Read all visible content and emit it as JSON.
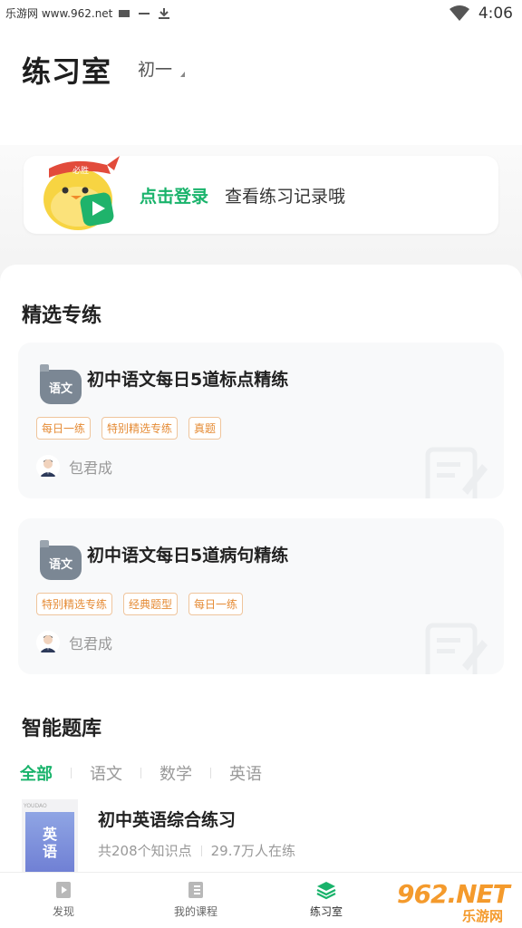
{
  "status_bar": {
    "site_text": "乐游网 www.962.net",
    "time": "4:06"
  },
  "header": {
    "title": "练习室",
    "grade": "初一"
  },
  "login_card": {
    "link_label": "点击登录",
    "tip": "查看练习记录哦",
    "mascot_badge": "必胜"
  },
  "featured": {
    "section_title": "精选专练",
    "cards": [
      {
        "subject": "语文",
        "title": "初中语文每日5道标点精练",
        "tags": [
          "每日一练",
          "特别精选专练",
          "真题"
        ],
        "teacher": "包君成"
      },
      {
        "subject": "语文",
        "title": "初中语文每日5道病句精练",
        "tags": [
          "特别精选专练",
          "经典题型",
          "每日一练"
        ],
        "teacher": "包君成"
      }
    ]
  },
  "bank": {
    "section_title": "智能题库",
    "tabs": [
      "全部",
      "语文",
      "数学",
      "英语"
    ],
    "active_tab": "全部",
    "items": [
      {
        "cover_brand": "YOUDAO",
        "cover_text_1": "英",
        "cover_text_2": "语",
        "title": "初中英语综合练习",
        "points": "共208个知识点",
        "learners": "29.7万人在练"
      }
    ]
  },
  "bottom_nav": {
    "items": [
      {
        "label": "发现",
        "icon": "play-book-icon"
      },
      {
        "label": "我的课程",
        "icon": "notebook-icon"
      },
      {
        "label": "练习室",
        "icon": "layers-icon"
      }
    ],
    "active": "练习室"
  },
  "watermark": {
    "main": "962.NET",
    "sub": "乐游网"
  },
  "colors": {
    "accent": "#19b36b",
    "tag": "#e58b35",
    "badge": "#7b8794"
  }
}
